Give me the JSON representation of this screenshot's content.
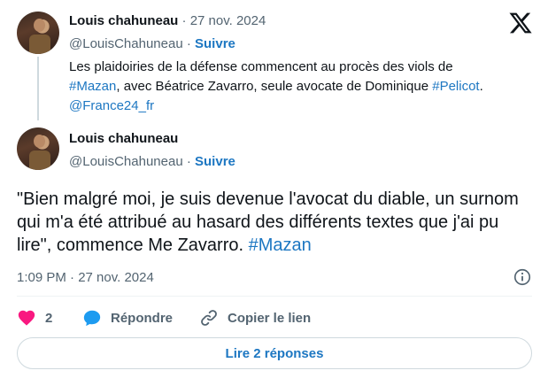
{
  "quoted": {
    "author_name": "Louis chahuneau",
    "date": "27 nov. 2024",
    "handle": "@LouisChahuneau",
    "follow_label": "Suivre",
    "text_1": "Les plaidoiries de la défense commencent au procès des viols de",
    "hashtag_1": "#Mazan",
    "text_2": ", avec Béatrice Zavarro, seule avocate de Dominique ",
    "hashtag_2": "#Pelicot",
    "text_3": ".",
    "mention": "@France24_fr"
  },
  "tweet": {
    "author_name": "Louis chahuneau",
    "handle": "@LouisChahuneau",
    "follow_label": "Suivre",
    "text": "\"Bien malgré moi, je suis devenue l'avocat du diable, un surnom qui m'a été attribué au hasard des différents textes que j'ai pu lire\", commence Me Zavarro. ",
    "hashtag": "#Mazan",
    "timestamp": "1:09 PM · 27 nov. 2024"
  },
  "actions": {
    "like_count": "2",
    "reply_label": "Répondre",
    "copy_label": "Copier le lien"
  },
  "replies_button_label": "Lire 2 réponses",
  "separator": "·",
  "icons": {
    "logo": "x-logo-icon",
    "like": "heart-icon",
    "reply": "reply-bubble-icon",
    "copy": "link-icon",
    "info": "info-icon"
  },
  "colors": {
    "link": "#1d77c2",
    "like": "#f91880",
    "muted": "#536471",
    "text": "#0f1419"
  }
}
